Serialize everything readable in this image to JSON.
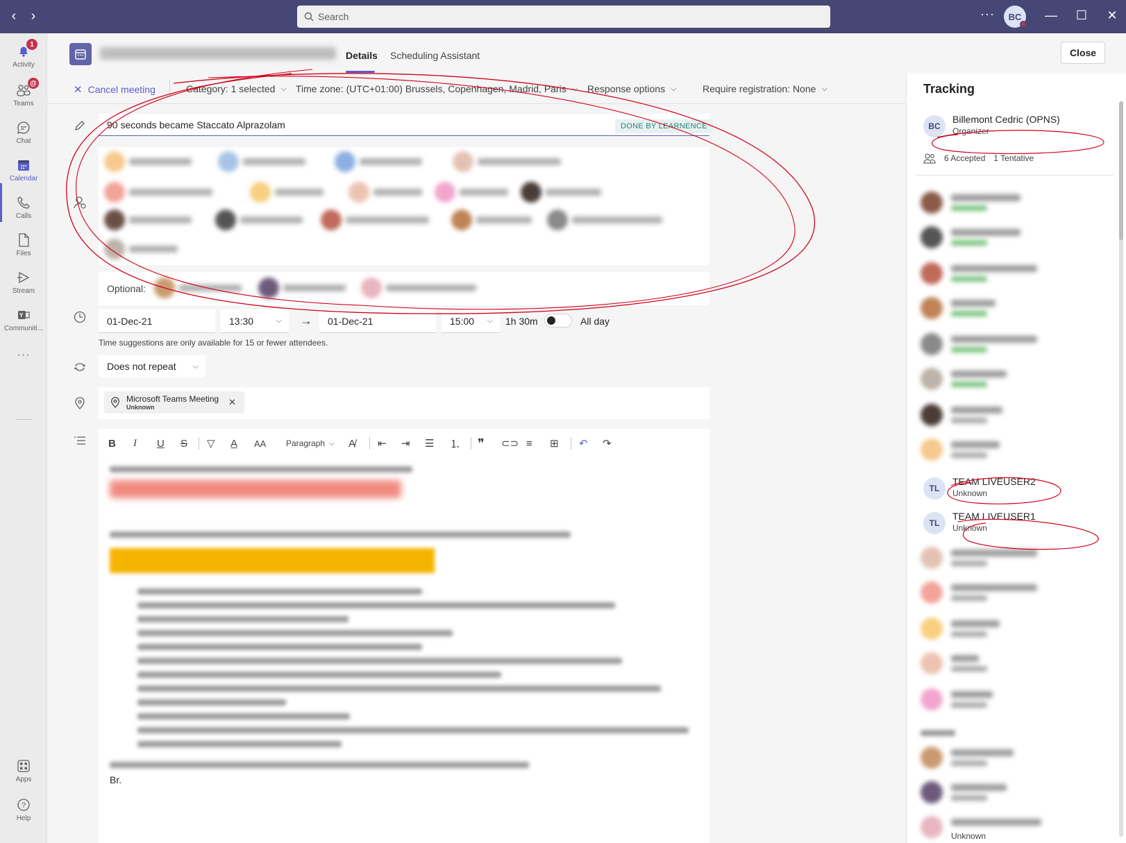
{
  "titlebar": {
    "search_placeholder": "Search",
    "avatar_initials": "BC",
    "more": "···"
  },
  "rail": {
    "items": [
      {
        "label": "Activity",
        "icon": "bell-icon",
        "badge": "1"
      },
      {
        "label": "Teams",
        "icon": "teams-icon",
        "badge": "@"
      },
      {
        "label": "Chat",
        "icon": "chat-icon"
      },
      {
        "label": "Calendar",
        "icon": "calendar-icon",
        "active": true
      },
      {
        "label": "Calls",
        "icon": "phone-icon"
      },
      {
        "label": "Files",
        "icon": "file-icon"
      },
      {
        "label": "Stream",
        "icon": "stream-icon"
      },
      {
        "label": "Communiti...",
        "icon": "yammer-icon"
      },
      {
        "label": "Apps",
        "icon": "apps-icon"
      },
      {
        "label": "Help",
        "icon": "help-icon"
      }
    ],
    "more": "···"
  },
  "header": {
    "tabs": [
      "Details",
      "Scheduling Assistant"
    ],
    "close_label": "Close"
  },
  "toolbar": {
    "cancel_label": "Cancel meeting",
    "category_label": "Category: 1 selected",
    "timezone_label": "Time zone: (UTC+01:00) Brussels, Copenhagen, Madrid, Paris",
    "response_label": "Response options",
    "registration_label": "Require registration: None"
  },
  "form": {
    "title_value": "90 seconds became Staccato Alprazolam",
    "done_tag": "DONE BY LEARNENCE",
    "optional_label": "Optional:",
    "start_date": "01-Dec-21",
    "start_time": "13:30",
    "end_date": "01-Dec-21",
    "end_time": "15:00",
    "duration": "1h 30m",
    "allday_label": "All day",
    "time_hint": "Time suggestions are only available for 15 or fewer attendees.",
    "repeat_value": "Does not repeat",
    "location_name": "Microsoft Teams Meeting",
    "location_status": "Unknown"
  },
  "editor": {
    "paragraph_label": "Paragraph",
    "signoff": "Br."
  },
  "tracking": {
    "title": "Tracking",
    "organizer": {
      "initials": "BC",
      "name": "Billemont Cedric (OPNS)",
      "role": "Organizer"
    },
    "accepted": "6 Accepted",
    "tentative": "1 Tentative",
    "team_users": [
      {
        "initials": "TL",
        "name": "TEAM LIVEUSER2",
        "status": "Unknown"
      },
      {
        "initials": "TL",
        "name": "TEAM LIVEUSER1",
        "status": "Unknown"
      }
    ],
    "last_status": "Unknown"
  },
  "colors": {
    "titlebar": "#464775",
    "accent": "#5b5fc7",
    "annotation": "#d0021b"
  }
}
